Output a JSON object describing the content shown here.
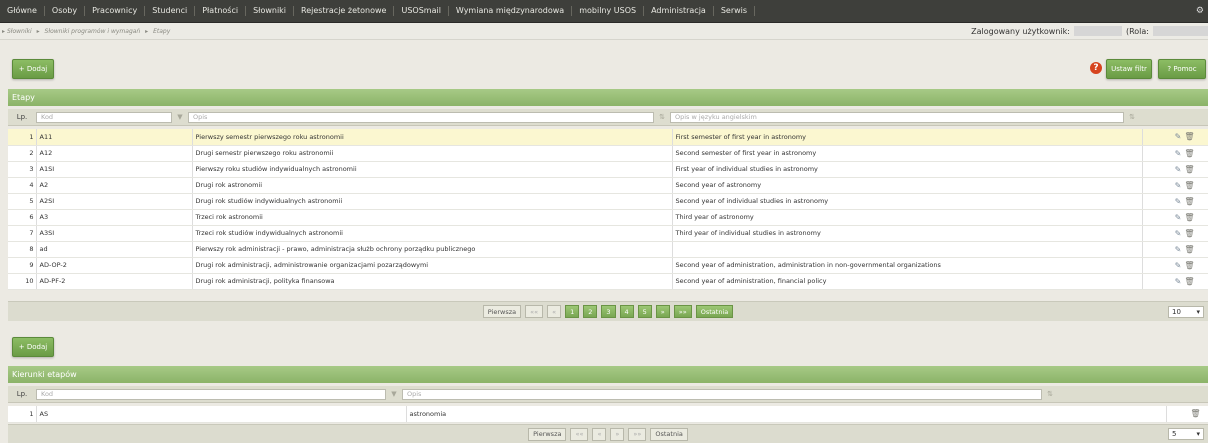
{
  "menu": [
    "Główne",
    "Osoby",
    "Pracownicy",
    "Studenci",
    "Płatności",
    "Słowniki",
    "Rejestracje żetonowe",
    "USOSmail",
    "Wymiana międzynarodowa",
    "mobilny USOS",
    "Administracja",
    "Serwis"
  ],
  "breadcrumb": [
    "Słowniki",
    "Słowniki programów i wymagań",
    "Etapy"
  ],
  "login": {
    "label": "Zalogowany użytkownik:",
    "role_label": "(Rola:"
  },
  "toolbar": {
    "add_label": "+ Dodaj",
    "filter_label": "Ustaw filtr",
    "help_label": "? Pomoc"
  },
  "etapy": {
    "title": "Etapy",
    "col_lp": "Lp.",
    "filter_kod": "Kod",
    "filter_opis": "Opis",
    "filter_opis_en": "Opis w języku angielskim",
    "rows": [
      {
        "lp": "1",
        "kod": "A11",
        "opis": "Pierwszy semestr pierwszego roku astronomii",
        "opis_en": "First semester of first year in astronomy"
      },
      {
        "lp": "2",
        "kod": "A12",
        "opis": "Drugi semestr pierwszego roku astronomii",
        "opis_en": "Second semester of first year in astronomy"
      },
      {
        "lp": "3",
        "kod": "A1SI",
        "opis": "Pierwszy roku studiów indywidualnych astronomii",
        "opis_en": "First year of individual studies in astronomy"
      },
      {
        "lp": "4",
        "kod": "A2",
        "opis": "Drugi rok astronomii",
        "opis_en": "Second year of astronomy"
      },
      {
        "lp": "5",
        "kod": "A2SI",
        "opis": "Drugi rok studiów indywidualnych astronomii",
        "opis_en": "Second year of individual studies in astronomy"
      },
      {
        "lp": "6",
        "kod": "A3",
        "opis": "Trzeci rok astronomii",
        "opis_en": "Third year of astronomy"
      },
      {
        "lp": "7",
        "kod": "A3SI",
        "opis": "Trzeci rok studiów indywidualnych astronomii",
        "opis_en": "Third year of individual studies in astronomy"
      },
      {
        "lp": "8",
        "kod": "ad",
        "opis": "Pierwszy rok administracji - prawo, administracja służb ochrony porządku publicznego",
        "opis_en": ""
      },
      {
        "lp": "9",
        "kod": "AD-OP-2",
        "opis": "Drugi rok administracji, administrowanie organizacjami pozarządowymi",
        "opis_en": "Second year of administration, administration in non-governmental organizations"
      },
      {
        "lp": "10",
        "kod": "AD-PF-2",
        "opis": "Drugi rok administracji, polityka finansowa",
        "opis_en": "Second year of administration, financial policy"
      }
    ],
    "pager": {
      "first": "Pierwsza",
      "last": "Ostatnia",
      "prev2": "««",
      "prev": "«",
      "next": "»",
      "next2": "»»",
      "pages": [
        "1",
        "2",
        "3",
        "4",
        "5"
      ],
      "page_size": "10"
    }
  },
  "kierunki": {
    "add_label": "+ Dodaj",
    "title": "Kierunki etapów",
    "col_lp": "Lp.",
    "filter_kod": "Kod",
    "filter_opis": "Opis",
    "rows": [
      {
        "lp": "1",
        "kod": "AS",
        "opis": "astronomia"
      }
    ],
    "pager": {
      "first": "Pierwsza",
      "last": "Ostatnia",
      "prev2": "««",
      "prev": "«",
      "next": "»",
      "next2": "»»",
      "page_size": "5"
    }
  },
  "icons": {
    "edit": "edit-icon",
    "delete": "trash-icon",
    "help": "help-icon",
    "settings": "gear-icon"
  }
}
